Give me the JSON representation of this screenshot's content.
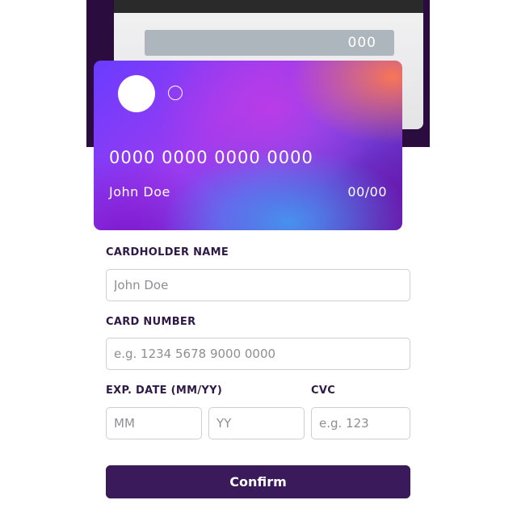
{
  "card_back": {
    "cvc": "000"
  },
  "card_front": {
    "number": "0000 0000 0000 0000",
    "name": "John Doe",
    "expiry": "00/00"
  },
  "form": {
    "cardholder_label": "CARDHOLDER NAME",
    "cardholder_placeholder": "John Doe",
    "card_number_label": "CARD NUMBER",
    "card_number_placeholder": "e.g. 1234 5678 9000 0000",
    "exp_label": "EXP. DATE (MM/YY)",
    "month_placeholder": "MM",
    "year_placeholder": "YY",
    "cvc_label": "CVC",
    "cvc_placeholder": "e.g. 123",
    "confirm_label": "Confirm"
  },
  "colors": {
    "accent_dark": "#21092f",
    "button": "#3b1a5c",
    "label": "#2f1a47"
  }
}
